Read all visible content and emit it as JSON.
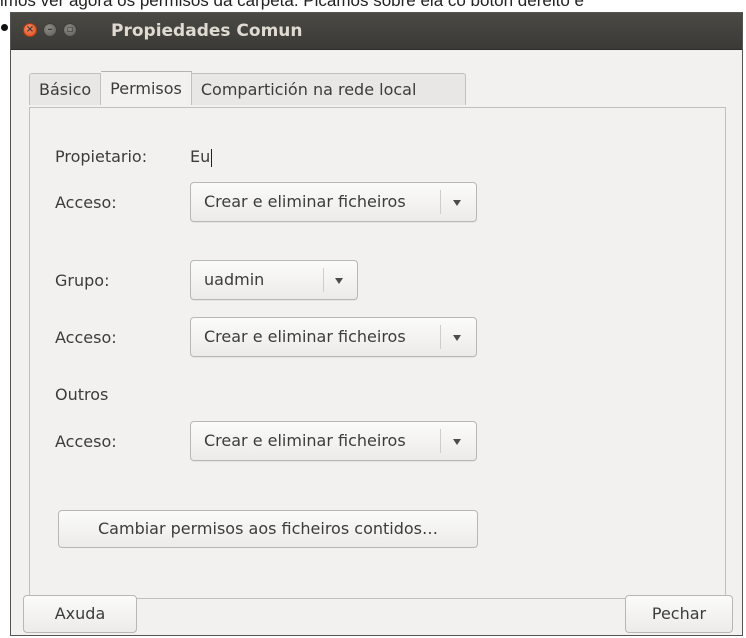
{
  "caption": "imos ver agora os permisos da carpeta. Picamos sobre ela co botón dereito e",
  "window": {
    "title": "Propiedades Comun"
  },
  "tabs": [
    {
      "label": "Básico",
      "active": false
    },
    {
      "label": "Permisos",
      "active": true
    },
    {
      "label": "Compartición na rede local",
      "active": false
    }
  ],
  "permissions": {
    "owner_label": "Propietario:",
    "owner_value": "Eu",
    "owner_access_label": "Acceso:",
    "owner_access_value": "Crear e eliminar ficheiros",
    "group_label": "Grupo:",
    "group_value": "uadmin",
    "group_access_label": "Acceso:",
    "group_access_value": "Crear e eliminar ficheiros",
    "others_label": "Outros",
    "others_access_label": "Acceso:",
    "others_access_value": "Crear e eliminar ficheiros",
    "change_contents_button": "Cambiar permisos aos ficheiros contidos…"
  },
  "footer": {
    "help_button": "Axuda",
    "close_button": "Pechar"
  },
  "icons": {
    "close": "close-icon",
    "minimize": "minimize-icon",
    "maximize": "maximize-icon",
    "dropdown": "chevron-down-icon"
  },
  "colors": {
    "titlebar": "#3c3b37",
    "title_text": "#dfdbd2",
    "close_button": "#df4a16",
    "window_bg": "#f2f1f0"
  }
}
